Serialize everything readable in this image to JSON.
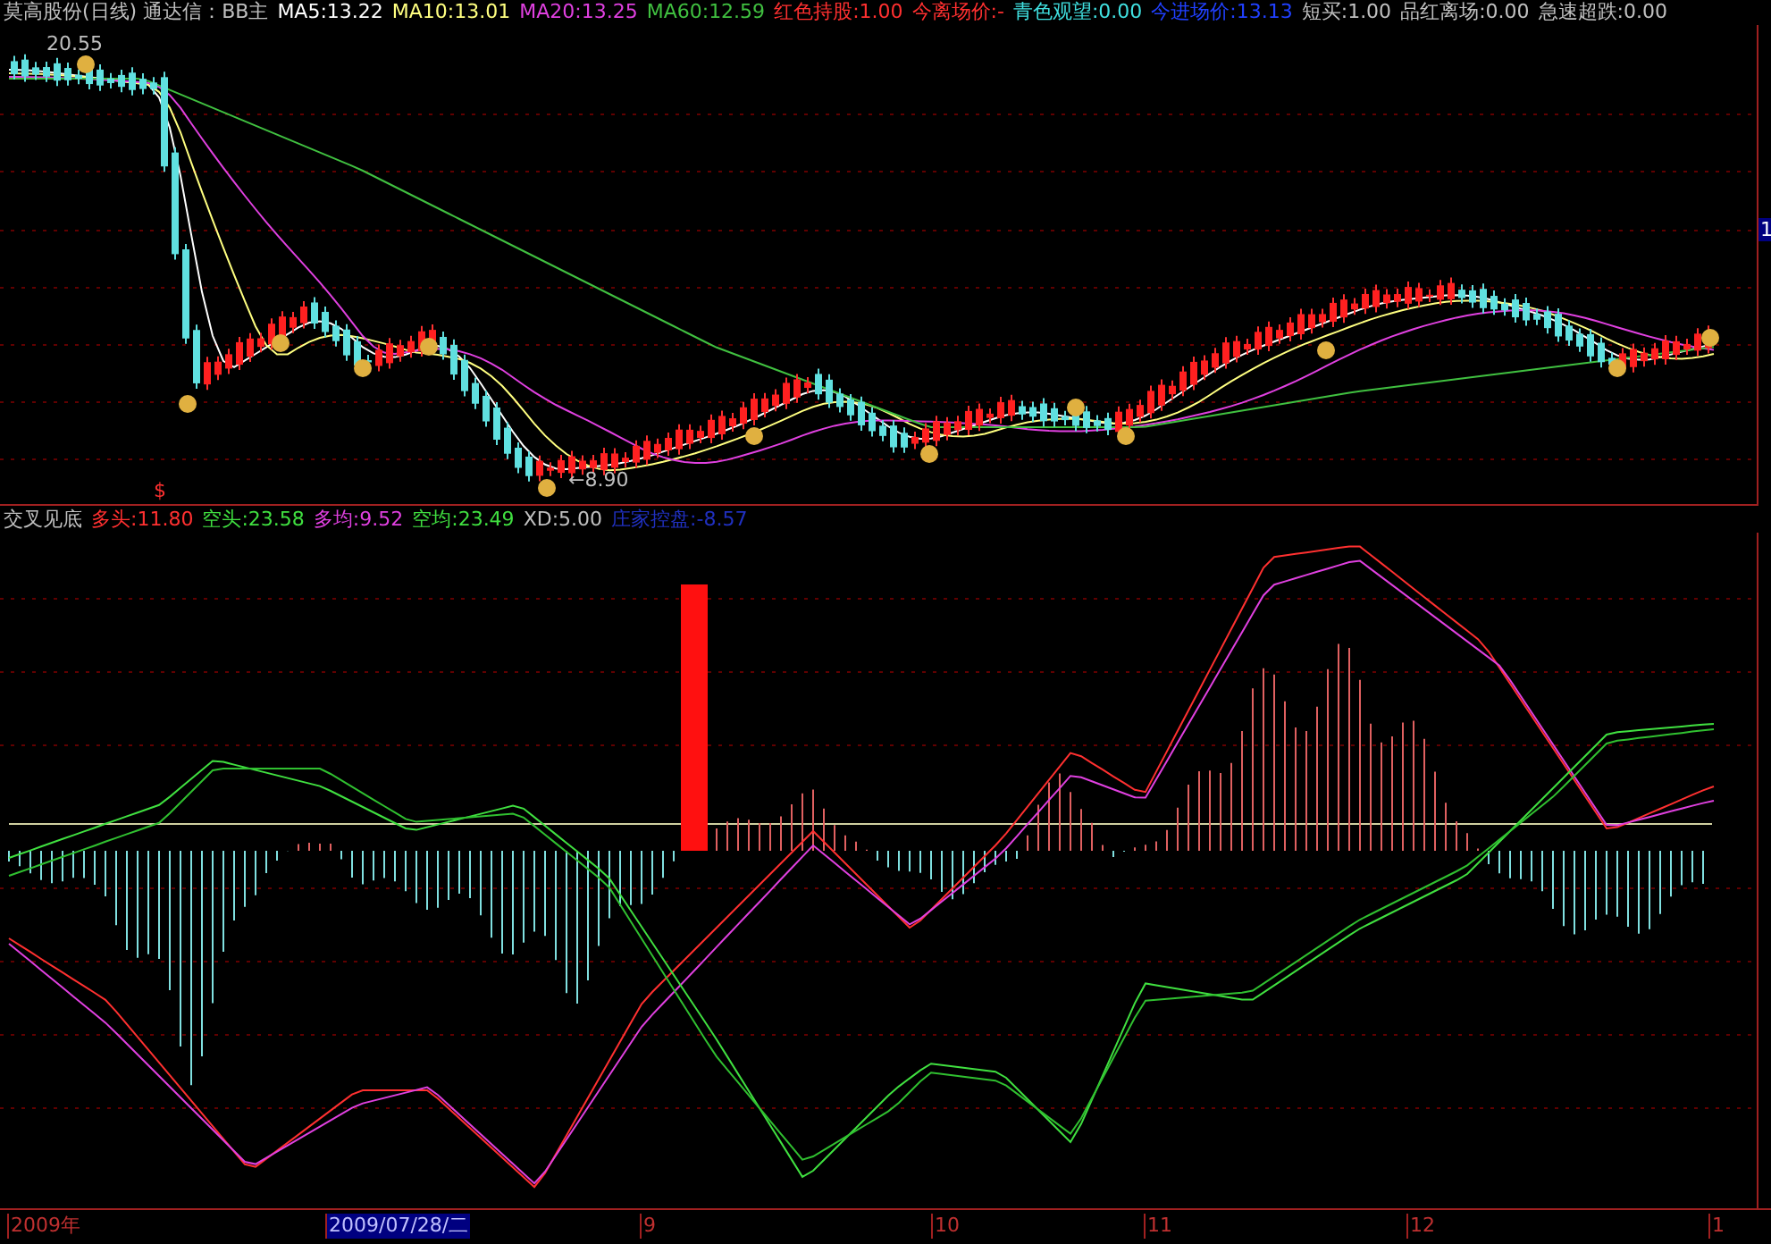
{
  "title_bar": {
    "items": [
      {
        "text": "莫高股份(日线) 通达信：BB主",
        "color": "#c0c0c0"
      },
      {
        "text": "MA5:13.22",
        "color": "#ffffff"
      },
      {
        "text": "MA10:13.01",
        "color": "#ffff80"
      },
      {
        "text": "MA20:13.25",
        "color": "#e040e0"
      },
      {
        "text": "MA60:12.59",
        "color": "#40c040"
      },
      {
        "text": "红色持股:1.00",
        "color": "#ff3030"
      },
      {
        "text": "今离场价:-",
        "color": "#ff3030"
      },
      {
        "text": "青色观望:0.00",
        "color": "#40e0e0"
      },
      {
        "text": "今进场价:13.13",
        "color": "#2040ff"
      },
      {
        "text": "短买:1.00",
        "color": "#c0c0c0"
      },
      {
        "text": "品红离场:0.00",
        "color": "#c0c0c0"
      },
      {
        "text": "急速超跌:0.00",
        "color": "#c0c0c0"
      }
    ]
  },
  "upper_panel": {
    "high_label": "20.55",
    "low_label": "←8.90",
    "marker": "$",
    "axis_label": "1"
  },
  "lower_panel": {
    "items": [
      {
        "text": "交叉见底",
        "color": "#c0c0c0"
      },
      {
        "text": "多头:11.80",
        "color": "#ff3030"
      },
      {
        "text": "空头:23.58",
        "color": "#40e040"
      },
      {
        "text": "多均:9.52",
        "color": "#e040e0"
      },
      {
        "text": "空均:23.49",
        "color": "#40e040"
      },
      {
        "text": "XD:5.00",
        "color": "#c0c0c0"
      },
      {
        "text": "庄家控盘:-8.57",
        "color": "#2030c0"
      }
    ]
  },
  "time_axis": [
    {
      "label": "2009年",
      "selected": false
    },
    {
      "label": "2009/07/28/二",
      "selected": true
    },
    {
      "label": "9",
      "selected": false
    },
    {
      "label": "10",
      "selected": false
    },
    {
      "label": "11",
      "selected": false
    },
    {
      "label": "12",
      "selected": false
    },
    {
      "label": "1",
      "selected": false
    }
  ]
}
